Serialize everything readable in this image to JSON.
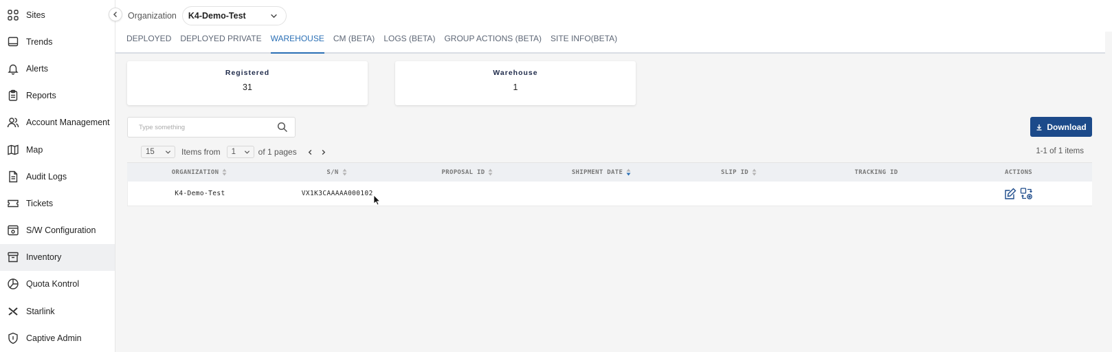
{
  "sidebar": {
    "items": [
      {
        "label": "Sites",
        "icon": "grid-icon"
      },
      {
        "label": "Trends",
        "icon": "monitor-icon"
      },
      {
        "label": "Alerts",
        "icon": "bell-icon"
      },
      {
        "label": "Reports",
        "icon": "clipboard-icon"
      },
      {
        "label": "Account Management",
        "icon": "users-icon"
      },
      {
        "label": "Map",
        "icon": "map-icon"
      },
      {
        "label": "Audit Logs",
        "icon": "document-icon"
      },
      {
        "label": "Tickets",
        "icon": "ticket-icon"
      },
      {
        "label": "S/W Configuration",
        "icon": "gear-window-icon"
      },
      {
        "label": "Inventory",
        "icon": "archive-box-icon",
        "active": true
      },
      {
        "label": "Quota Kontrol",
        "icon": "pie-icon"
      },
      {
        "label": "Starlink",
        "icon": "starlink-x-icon"
      },
      {
        "label": "Captive Admin",
        "icon": "shield-icon"
      }
    ]
  },
  "header": {
    "org_label": "Organization",
    "org_value": "K4-Demo-Test"
  },
  "tabs": [
    {
      "label": "DEPLOYED"
    },
    {
      "label": "DEPLOYED PRIVATE"
    },
    {
      "label": "WAREHOUSE",
      "active": true
    },
    {
      "label": "CM (BETA)"
    },
    {
      "label": "LOGS (BETA)"
    },
    {
      "label": "GROUP ACTIONS (BETA)"
    },
    {
      "label": "SITE INFO(BETA)"
    }
  ],
  "stats": {
    "registered": {
      "label": "Registered",
      "value": "31"
    },
    "warehouse": {
      "label": "Warehouse",
      "value": "1"
    }
  },
  "search": {
    "placeholder": "Type something",
    "value": ""
  },
  "download_label": "Download",
  "pager": {
    "page_size": "15",
    "items_from_label": "Items from",
    "page": "1",
    "of_pages": "of 1 pages",
    "items_count": "1-1 of 1 items"
  },
  "table": {
    "columns": [
      "ORGANIZATION",
      "S/N",
      "PROPOSAL ID",
      "SHIPMENT DATE",
      "SLIP ID",
      "TRACKING ID",
      "ACTIONS"
    ],
    "rows": [
      {
        "organization": "K4-Demo-Test",
        "sn": "VX1K3CAAAAA000102",
        "proposal_id": "",
        "shipment_date": "",
        "slip_id": "",
        "tracking_id": ""
      }
    ]
  },
  "colors": {
    "accent": "#2a6fb5",
    "download_bg": "#1c4a8a",
    "sort_active": "#2a6fb5"
  }
}
